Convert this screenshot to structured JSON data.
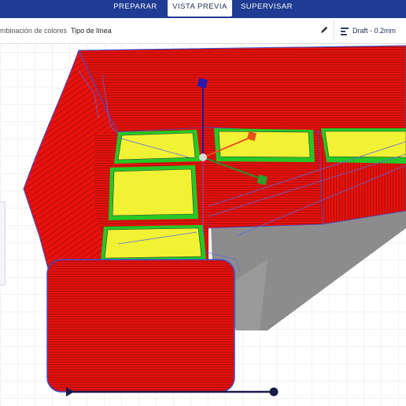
{
  "stages": {
    "prepare": "PREPARAR",
    "preview": "VISTA PREVIA",
    "monitor": "SUPERVISAR",
    "active": "preview"
  },
  "toolbar": {
    "color_scheme_label": "mbinación de colores",
    "color_scheme_value": "Tipo de línea",
    "edit_icon": "pencil-icon",
    "profile_icon": "print-settings-icon",
    "profile_label": "Draft - 0.2mm"
  },
  "colors": {
    "header_bg": "#1f3b93",
    "wall_outer": "#e8120d",
    "infill": "#f2f235",
    "inner_wall": "#25c825",
    "travel": "#3b4fd6",
    "shadow": "#8c8c8c"
  },
  "handles": {
    "x_handle": "red-cube-handle",
    "y_handle": "green-cube-handle",
    "z_handle": "blue-cube-handle"
  },
  "layer_slider": {
    "handle_start": "slider-start-handle",
    "handle_end": "slider-end-handle"
  }
}
